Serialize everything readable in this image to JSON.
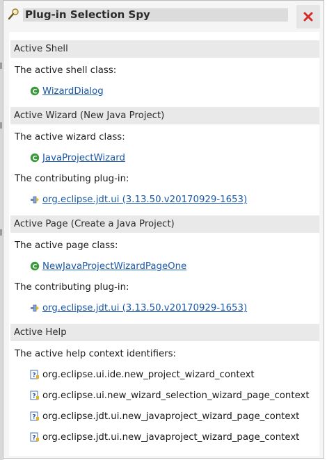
{
  "title": "Plug-in Selection Spy",
  "sections": [
    {
      "header": "Active Shell",
      "rows": [
        {
          "label": "The active shell class:"
        },
        {
          "entry": "WizardDialog",
          "icon": "class-icon"
        }
      ]
    },
    {
      "header": "Active Wizard (New Java Project)",
      "rows": [
        {
          "label": "The active wizard class:"
        },
        {
          "entry": "JavaProjectWizard",
          "icon": "class-icon"
        },
        {
          "label": "The contributing plug-in:"
        },
        {
          "entry": "org.eclipse.jdt.ui (3.13.50.v20170929-1653)",
          "icon": "plugin-icon"
        }
      ]
    },
    {
      "header": "Active Page (Create a Java Project)",
      "rows": [
        {
          "label": "The active page class:"
        },
        {
          "entry": "NewJavaProjectWizardPageOne",
          "icon": "class-icon"
        },
        {
          "label": "The contributing plug-in:"
        },
        {
          "entry": "org.eclipse.jdt.ui (3.13.50.v20170929-1653)",
          "icon": "plugin-icon"
        }
      ]
    },
    {
      "header": "Active Help",
      "rows": [
        {
          "label": "The active help context identifiers:"
        },
        {
          "entry": "org.eclipse.ui.ide.new_project_wizard_context",
          "icon": "help-context-icon"
        },
        {
          "entry": "org.eclipse.ui.new_wizard_selection_wizard_page_context",
          "icon": "help-context-icon"
        },
        {
          "entry": "org.eclipse.jdt.ui.new_javaproject_wizard_page_context",
          "icon": "help-context-icon"
        },
        {
          "entry": "org.eclipse.jdt.ui.new_javaproject_wizard_page_context",
          "icon": "help-context-icon"
        }
      ]
    }
  ],
  "colors": {
    "link": "#1a58a8",
    "class_icon": "#3b9a3b",
    "close_icon": "#d42a2a",
    "section_bg": "#e9e9e9"
  }
}
